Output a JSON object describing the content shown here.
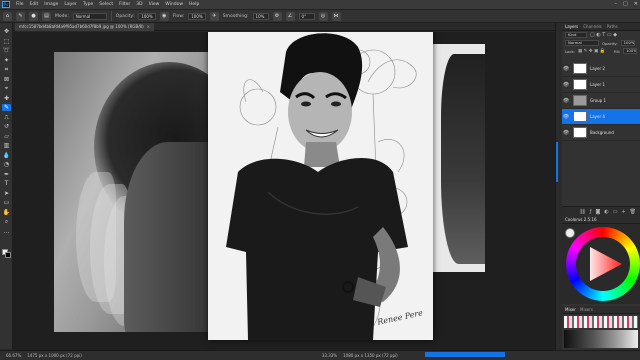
{
  "menubar": {
    "logo": "Ps",
    "items": [
      "File",
      "Edit",
      "Image",
      "Layer",
      "Type",
      "Select",
      "Filter",
      "3D",
      "View",
      "Window",
      "Help"
    ],
    "controls": [
      "–",
      "□",
      "✕"
    ]
  },
  "options": {
    "mode_label": "Mode:",
    "mode_value": "Normal",
    "opacity_label": "Opacity:",
    "opacity_value": "100%",
    "flow_label": "Flow:",
    "flow_value": "100%",
    "smoothing_label": "Smoothing:",
    "smoothing_value": "10%",
    "angle_value": "0°"
  },
  "document": {
    "tab_title": "mfcc1587bd4b8afd4a9f95ad7b60d7f8b9.jpg @ 100% (RGB/8)",
    "signature": "Renee Pere"
  },
  "toolbar": {
    "tools": [
      "move",
      "marquee",
      "lasso",
      "quick-select",
      "crop",
      "frame",
      "eyedropper",
      "healing",
      "brush",
      "clone-stamp",
      "history-brush",
      "eraser",
      "gradient",
      "blur",
      "dodge",
      "pen",
      "type",
      "path-select",
      "rectangle",
      "hand",
      "zoom",
      "more"
    ],
    "active_tool": "brush"
  },
  "layers": {
    "tabs": [
      "Layers",
      "Channels",
      "Paths"
    ],
    "kind_label": "Kind",
    "blend_mode": "Normal",
    "opacity_label": "Opacity:",
    "opacity_value": "100%",
    "lock_label": "Lock:",
    "fill_label": "Fill:",
    "fill_value": "100%",
    "rows": [
      {
        "name": "Layer 2",
        "thumb": "white"
      },
      {
        "name": "Layer 1",
        "thumb": "white"
      },
      {
        "name": "Group 1",
        "thumb": "grey"
      },
      {
        "name": "Layer 4",
        "thumb": "white"
      },
      {
        "name": "Background",
        "thumb": "white"
      }
    ],
    "selected_index": 3,
    "footer_icons": [
      "link-icon",
      "fx-icon",
      "mask-icon",
      "adjustment-icon",
      "folder-icon",
      "new-layer-icon",
      "trash-icon"
    ]
  },
  "color_panel": {
    "title": "Coolorus 2.5.16",
    "foreground": "#eeeeee"
  },
  "mixer_panel": {
    "tabs": [
      "Mixer",
      "Mixers"
    ]
  },
  "status": {
    "zoom": "66.67%",
    "doc_info": "1475 px x 1000 px (72 ppi)",
    "right_zoom": "33.33%",
    "right_doc_info": "1080 px x 1350 px (72 ppi)"
  },
  "colors": {
    "accent": "#1473e6",
    "panel_bg": "#323232",
    "canvas_bg": "#1f1f1f"
  }
}
